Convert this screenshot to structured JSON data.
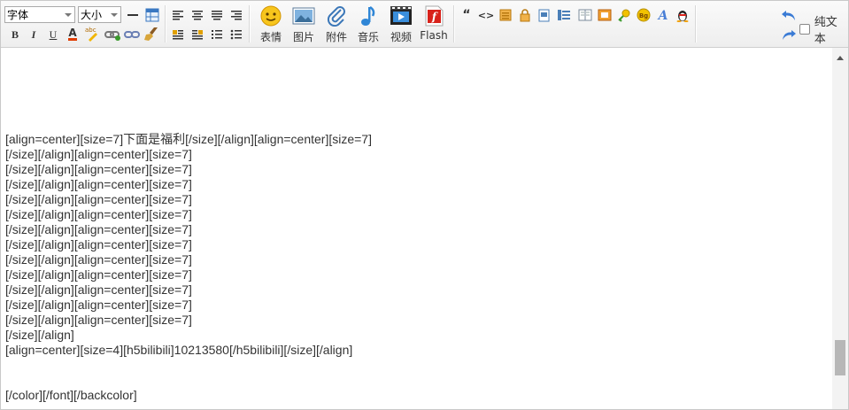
{
  "toolbar": {
    "font_select": "字体",
    "size_select": "大小",
    "bold": "B",
    "italic": "I",
    "underline": "U",
    "font_color": "A",
    "spell": "abc",
    "quote": "“",
    "code": "<>",
    "big_buttons": [
      {
        "label": "表情",
        "icon": "emoji-icon"
      },
      {
        "label": "图片",
        "icon": "image-icon"
      },
      {
        "label": "附件",
        "icon": "attachment-icon"
      },
      {
        "label": "音乐",
        "icon": "music-icon"
      },
      {
        "label": "视频",
        "icon": "video-icon"
      },
      {
        "label": "Flash",
        "icon": "flash-icon"
      }
    ],
    "plain_text_label": "纯文本",
    "plain_text_checked": false,
    "bg_badge": "Bg"
  },
  "content": {
    "lines": [
      "[align=center][size=7]下面是福利[/size][/align][align=center][size=7]",
      "[/size][/align][align=center][size=7]",
      "[/size][/align][align=center][size=7]",
      "[/size][/align][align=center][size=7]",
      "[/size][/align][align=center][size=7]",
      "[/size][/align][align=center][size=7]",
      "[/size][/align][align=center][size=7]",
      "[/size][/align][align=center][size=7]",
      "[/size][/align][align=center][size=7]",
      "[/size][/align][align=center][size=7]",
      "[/size][/align][align=center][size=7]",
      "[/size][/align][align=center][size=7]",
      "[/size][/align][align=center][size=7]",
      "[/size][/align]",
      "[align=center][size=4][h5bilibili]10213580[/h5bilibili][/size][/align]",
      "",
      "",
      "[/color][/font][/backcolor]"
    ]
  }
}
